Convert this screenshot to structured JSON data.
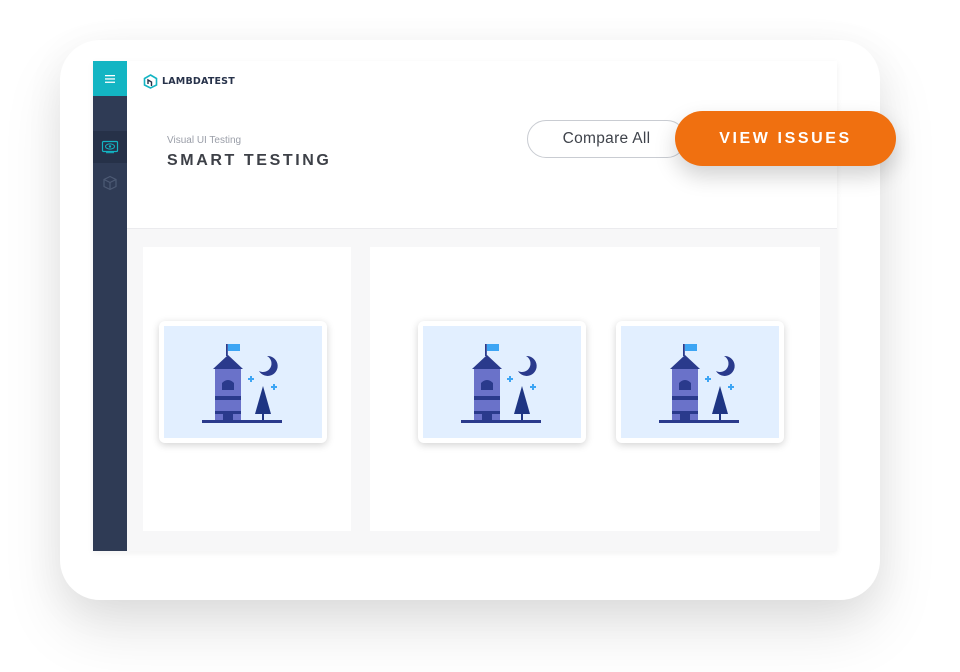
{
  "brand": {
    "logo_text_prefix": "LAMBDA",
    "logo_text_suffix": "TEST",
    "accent": "#13b5c3",
    "sidebar_bg": "#2f3b55"
  },
  "header": {
    "subtitle": "Visual UI Testing",
    "title": "SMART TESTING"
  },
  "actions": {
    "compare_label": "Compare All",
    "view_issues_label": "VIEW ISSUES",
    "view_issues_color": "#f07010"
  },
  "sidebar": {
    "items": [
      {
        "icon": "menu-icon"
      },
      {
        "icon": "eye-monitor-icon"
      },
      {
        "icon": "box-icon"
      }
    ]
  },
  "thumbnails": {
    "illustration": "castle-night-illustration"
  }
}
